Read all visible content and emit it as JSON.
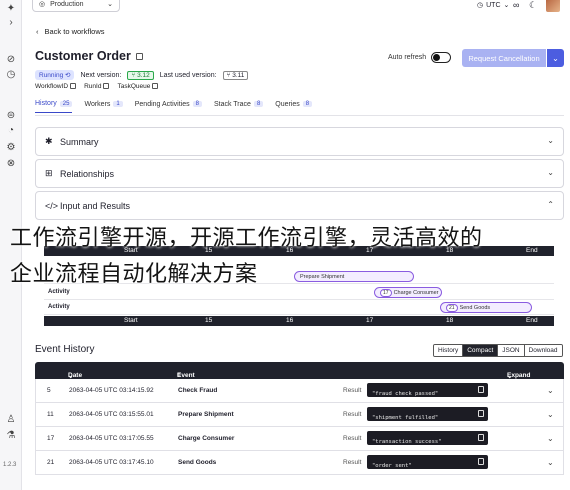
{
  "topbar": {
    "namespace": "Production",
    "timezone": "UTC"
  },
  "header": {
    "back_label": "Back to workflows",
    "title": "Customer Order",
    "auto_refresh_label": "Auto refresh",
    "request_cancel_label": "Request Cancellation",
    "status": "Running",
    "next_version_label": "Next version:",
    "next_version": "3.12",
    "last_used_label": "Last used version:",
    "last_used": "3.11",
    "meta": [
      "WorkflowID",
      "RunId",
      "TaskQueue"
    ]
  },
  "tabs": [
    {
      "label": "History",
      "count": "25"
    },
    {
      "label": "Workers",
      "count": "1"
    },
    {
      "label": "Pending Activities",
      "count": "8"
    },
    {
      "label": "Stack Trace",
      "count": "8"
    },
    {
      "label": "Queries",
      "count": "8"
    }
  ],
  "panels": [
    {
      "label": "Summary"
    },
    {
      "label": "Relationships"
    },
    {
      "label": "Input and Results"
    }
  ],
  "timeline": {
    "axis_ticks": [
      "Start",
      "15",
      "16",
      "17",
      "18",
      "End"
    ],
    "row_labels": [
      "Activity",
      "Activity"
    ],
    "bars": [
      {
        "num": "",
        "label": "Prepare Shipment"
      },
      {
        "num": "17",
        "label": "Charge Consumer"
      },
      {
        "num": "21",
        "label": "Send Goods"
      }
    ]
  },
  "overlay": {
    "line1": "工作流引擎开源，开源工作流引擎，灵活高效的",
    "line2": "企业流程自动化解决方案"
  },
  "event_history": {
    "title": "Event History",
    "views": [
      "History",
      "Compact",
      "JSON",
      "Download"
    ],
    "columns": {
      "date": "Date & Time",
      "type": "Event Type",
      "expand": "Expand all"
    },
    "rows": [
      {
        "id": "5",
        "date": "2063-04-05 UTC 03:14:15.92",
        "type": "Check Fraud",
        "result_label": "Result",
        "result": "\"fraud check passed\""
      },
      {
        "id": "11",
        "date": "2063-04-05 UTC 03:15:55.01",
        "type": "Prepare Shipment",
        "result_label": "Result",
        "result": "\"shipment fulfilled\""
      },
      {
        "id": "17",
        "date": "2063-04-05 UTC 03:17:05.55",
        "type": "Charge Consumer",
        "result_label": "Result",
        "result": "\"transaction success\""
      },
      {
        "id": "21",
        "date": "2063-04-05 UTC 03:17:45.10",
        "type": "Send Goods",
        "result_label": "Result",
        "result": "\"order sent\""
      }
    ]
  },
  "rail": {
    "version": "1.2.3"
  }
}
